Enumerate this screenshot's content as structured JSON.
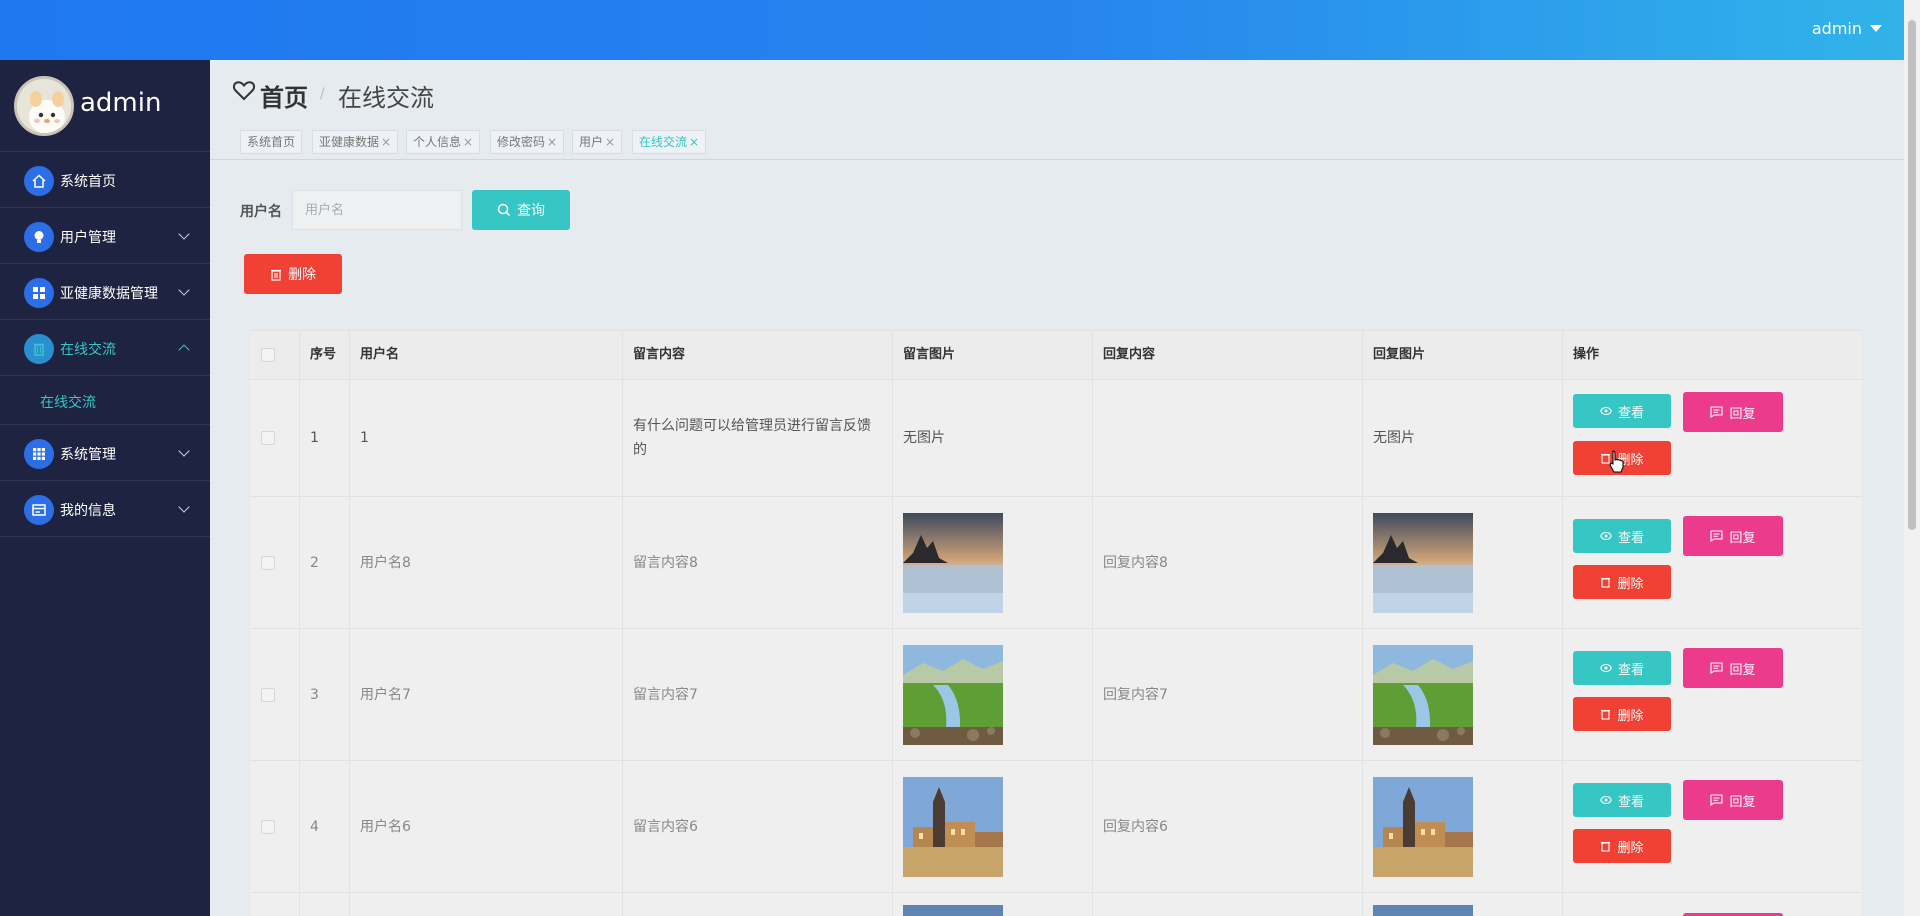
{
  "topbar": {
    "user": "admin"
  },
  "sidebar": {
    "profile_name": "admin",
    "items": [
      {
        "label": "系统首页",
        "icon": "home-icon",
        "has_arrow": false
      },
      {
        "label": "用户管理",
        "icon": "bulb-icon",
        "has_arrow": true
      },
      {
        "label": "亚健康数据管理",
        "icon": "grid-icon",
        "has_arrow": true
      },
      {
        "label": "在线交流",
        "icon": "trash-icon",
        "has_arrow": true,
        "active": true
      },
      {
        "label": "系统管理",
        "icon": "apps-icon",
        "has_arrow": true
      },
      {
        "label": "我的信息",
        "icon": "card-icon",
        "has_arrow": true
      }
    ],
    "submenu_label": "在线交流"
  },
  "header": {
    "home": "首页",
    "separator": "/",
    "current": "在线交流"
  },
  "tabs": [
    {
      "label": "系统首页",
      "closable": false
    },
    {
      "label": "亚健康数据",
      "closable": true
    },
    {
      "label": "个人信息",
      "closable": true
    },
    {
      "label": "修改密码",
      "closable": true
    },
    {
      "label": "用户",
      "closable": true
    },
    {
      "label": "在线交流",
      "closable": true,
      "active": true
    }
  ],
  "search": {
    "label": "用户名",
    "placeholder": "用户名",
    "button": "查询"
  },
  "toolbar": {
    "delete_label": "删除"
  },
  "table": {
    "headers": [
      "序号",
      "用户名",
      "留言内容",
      "留言图片",
      "回复内容",
      "回复图片",
      "操作"
    ],
    "rows": [
      {
        "index": "1",
        "username": "1",
        "content": "有什么问题可以给管理员进行留言反馈的",
        "image": "无图片",
        "reply": "",
        "reply_image": "无图片"
      },
      {
        "index": "2",
        "username": "用户名8",
        "content": "留言内容8",
        "image": "lake",
        "reply": "回复内容8",
        "reply_image": "lake"
      },
      {
        "index": "3",
        "username": "用户名7",
        "content": "留言内容7",
        "image": "meadow",
        "reply": "回复内容7",
        "reply_image": "meadow"
      },
      {
        "index": "4",
        "username": "用户名6",
        "content": "留言内容6",
        "image": "castle",
        "reply": "回复内容6",
        "reply_image": "castle"
      }
    ],
    "actions": {
      "view": "查看",
      "reply": "回复",
      "delete": "删除"
    }
  },
  "colors": {
    "accent": "#36c7c4",
    "danger": "#f04134",
    "pink": "#ec3a8d",
    "sidebar": "#1d2340",
    "topbar": "#1f78f0"
  }
}
